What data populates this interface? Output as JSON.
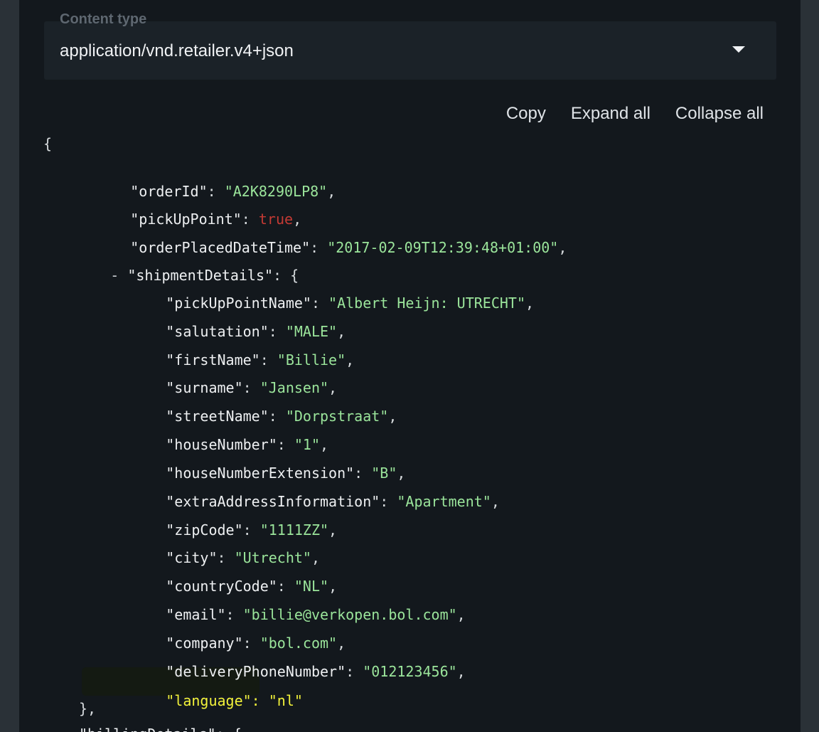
{
  "content_type": {
    "label": "Content type",
    "value": "application/vnd.retailer.v4+json",
    "dropdown_icon": "caret-down-icon"
  },
  "toolbar": {
    "copy_label": "Copy",
    "expand_label": "Expand all",
    "collapse_label": "Collapse all"
  },
  "json": {
    "open_brace": "{",
    "collapse_toggle": "-",
    "root": [
      {
        "key": "\"orderId\"",
        "value": "\"A2K8290LP8\""
      },
      {
        "key": "\"pickUpPoint\"",
        "value": "true"
      },
      {
        "key": "\"orderPlacedDateTime\"",
        "value": "\"2017-02-09T12:39:48+01:00\""
      },
      {
        "key": "\"shipmentDetails\"",
        "value": "{"
      }
    ],
    "shipment": [
      {
        "key": "\"pickUpPointName\"",
        "value": "\"Albert Heijn: UTRECHT\""
      },
      {
        "key": "\"salutation\"",
        "value": "\"MALE\""
      },
      {
        "key": "\"firstName\"",
        "value": "\"Billie\""
      },
      {
        "key": "\"surname\"",
        "value": "\"Jansen\""
      },
      {
        "key": "\"streetName\"",
        "value": "\"Dorpstraat\""
      },
      {
        "key": "\"houseNumber\"",
        "value": "\"1\""
      },
      {
        "key": "\"houseNumberExtension\"",
        "value": "\"B\""
      },
      {
        "key": "\"extraAddressInformation\"",
        "value": "\"Apartment\""
      },
      {
        "key": "\"zipCode\"",
        "value": "\"1111ZZ\""
      },
      {
        "key": "\"city\"",
        "value": "\"Utrecht\""
      },
      {
        "key": "\"countryCode\"",
        "value": "\"NL\""
      },
      {
        "key": "\"email\"",
        "value": "\"billie@verkopen.bol.com\""
      },
      {
        "key": "\"company\"",
        "value": "\"bol.com\""
      },
      {
        "key": "\"deliveryPhoneNumber\"",
        "value": "\"012123456\""
      },
      {
        "key": "\"language\"",
        "value": "\"nl\""
      }
    ],
    "close_shipment": "},",
    "partial_next_line": "\"billingDetails\": {",
    "colon": ": ",
    "comma": ","
  },
  "colors": {
    "background": "#13181d",
    "string": "#9be59b",
    "boolean": "#c43a34",
    "highlight": "#f2f23a"
  }
}
